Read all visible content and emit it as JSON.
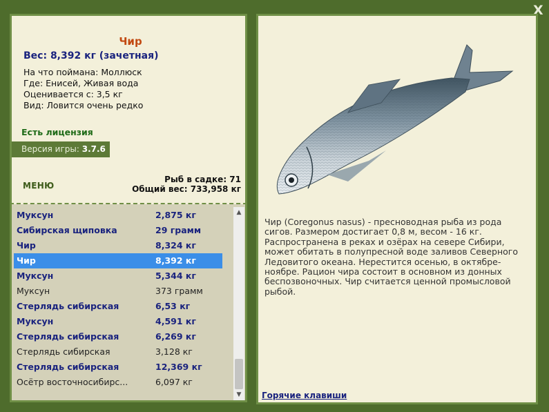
{
  "window": {
    "close_label": "X"
  },
  "fish": {
    "name": "Чир",
    "weight": "Вес: 8,392 кг (зачетная)",
    "caught_on": "На что поймана: Моллюск",
    "where": "Где: Енисей, Живая вода",
    "rated_from": "Оценивается с: 3,5 кг",
    "kind": "Вид: Ловится очень редко"
  },
  "license": "Есть лицензия",
  "version": {
    "label": "Версия игры:",
    "value": "3.7.6"
  },
  "menu_label": "МЕНЮ",
  "stats": {
    "fish_in_keepnet": "Рыб в садке: 71",
    "total_weight": "Общий вес: 733,958 кг"
  },
  "catch_list": [
    {
      "name": "Муксун",
      "weight": "2,875 кг",
      "style": "bold"
    },
    {
      "name": "Сибирская щиповка",
      "weight": "29 грамм",
      "style": "bold"
    },
    {
      "name": "Чир",
      "weight": "8,324 кг",
      "style": "bold"
    },
    {
      "name": "Чир",
      "weight": "8,392 кг",
      "style": "selected"
    },
    {
      "name": "Муксун",
      "weight": "5,344 кг",
      "style": "bold"
    },
    {
      "name": "Муксун",
      "weight": "373 грамм",
      "style": "plain"
    },
    {
      "name": "Стерлядь сибирская",
      "weight": "6,53 кг",
      "style": "bold"
    },
    {
      "name": "Муксун",
      "weight": "4,591 кг",
      "style": "bold"
    },
    {
      "name": "Стерлядь сибирская",
      "weight": "6,269 кг",
      "style": "bold"
    },
    {
      "name": "Стерлядь сибирская",
      "weight": "3,128 кг",
      "style": "plain"
    },
    {
      "name": "Стерлядь сибирская",
      "weight": "12,369 кг",
      "style": "bold"
    },
    {
      "name": "Осётр восточносибирс...",
      "weight": "6,097 кг",
      "style": "plain"
    }
  ],
  "description": "Чир (Coregonus nasus) - пресноводная рыба из рода сигов. Размером достигает 0,8 м, весом - 16 кг. Распространена в реках и озёрах на севере Сибири, может обитать в полупресной воде заливов Северного Ледовитого океана. Нерестится осенью, в октябре-ноябре. Рацион чира состоит в основном из донных беспозвоночных. Чир считается ценной промысловой рыбой.",
  "hotkeys_label": "Горячие клавиши",
  "colors": {
    "background": "#4e6c2c",
    "panel": "#f3f0da",
    "list_background": "#d4d1b9",
    "selection": "#3b8ee8",
    "accent_title": "#c24a12",
    "link": "#1a237e"
  }
}
